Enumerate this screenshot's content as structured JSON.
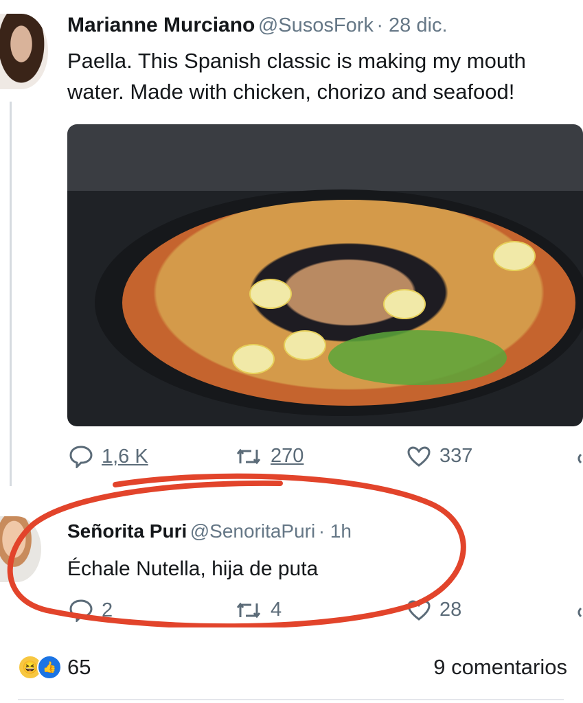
{
  "tweet": {
    "author_name": "Marianne Murciano",
    "author_handle": "@SusosFork",
    "date": "· 28 dic.",
    "text": "Paella. This Spanish classic is making my mouth water. Made with chicken, chorizo and seafood!",
    "stats": {
      "replies": "1,6 K",
      "retweets": "270",
      "likes": "337"
    }
  },
  "reply": {
    "author_name": "Señorita Puri",
    "author_handle": "@SenoritaPuri",
    "date": "· 1h",
    "text": "Échale Nutella, hija de puta",
    "stats": {
      "replies": "2",
      "retweets": "4",
      "likes": "28"
    }
  },
  "facebook": {
    "reactions": [
      "haha-icon",
      "like-icon"
    ],
    "reaction_count": "65",
    "comments_label": "9 comentarios"
  },
  "colors": {
    "annotation_circle": "#e2442b",
    "icon_gray": "#5b6b78"
  }
}
